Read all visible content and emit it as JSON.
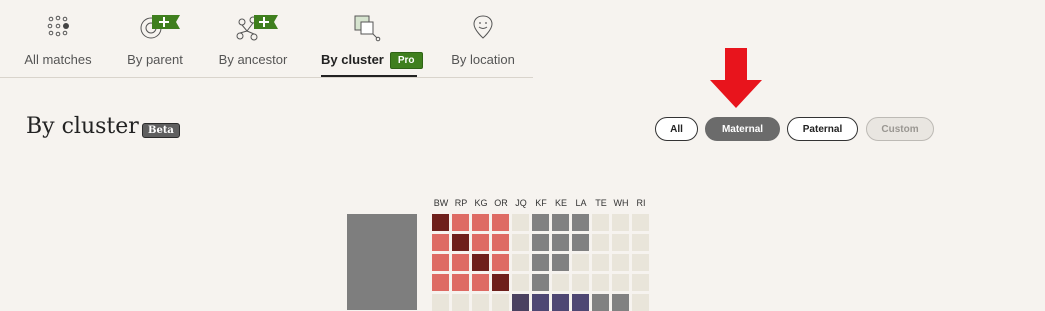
{
  "tabs": [
    {
      "label": "All matches",
      "icon": "all-matches-icon",
      "active": false,
      "plus": false
    },
    {
      "label": "By parent",
      "icon": "by-parent-icon",
      "active": false,
      "plus": true
    },
    {
      "label": "By ancestor",
      "icon": "by-ancestor-icon",
      "active": false,
      "plus": true
    },
    {
      "label": "By cluster",
      "icon": "by-cluster-icon",
      "active": true,
      "badge": "Pro"
    },
    {
      "label": "By location",
      "icon": "by-location-icon",
      "active": false,
      "plus": false
    }
  ],
  "page": {
    "title": "By cluster",
    "badge": "Beta"
  },
  "filters": {
    "all": "All",
    "maternal": "Maternal",
    "paternal": "Paternal",
    "custom": "Custom",
    "selected": "Maternal"
  },
  "matrix": {
    "columns": [
      "BW",
      "RP",
      "KG",
      "OR",
      "JQ",
      "KF",
      "KE",
      "LA",
      "TE",
      "WH",
      "RI"
    ],
    "colors": {
      "D": "#6e1f1b",
      "R": "#de6b64",
      "G": "#818181",
      "P": "#4e4773",
      "B": "#4a4160",
      "C": "#e9e5da"
    },
    "rows": [
      [
        "D",
        "R",
        "R",
        "R",
        "C",
        "G",
        "G",
        "G",
        "C",
        "C",
        "C"
      ],
      [
        "R",
        "D",
        "R",
        "R",
        "C",
        "G",
        "G",
        "G",
        "C",
        "C",
        "C"
      ],
      [
        "R",
        "R",
        "D",
        "R",
        "C",
        "G",
        "G",
        "C",
        "C",
        "C",
        "C"
      ],
      [
        "R",
        "R",
        "R",
        "D",
        "C",
        "G",
        "C",
        "C",
        "C",
        "C",
        "C"
      ],
      [
        "C",
        "C",
        "C",
        "C",
        "B",
        "P",
        "P",
        "P",
        "G",
        "G",
        "C"
      ]
    ]
  },
  "colors": {
    "accent_green": "#3f7f1e",
    "arrow_red": "#e8141c",
    "selected_gray": "#6b6b6b"
  }
}
